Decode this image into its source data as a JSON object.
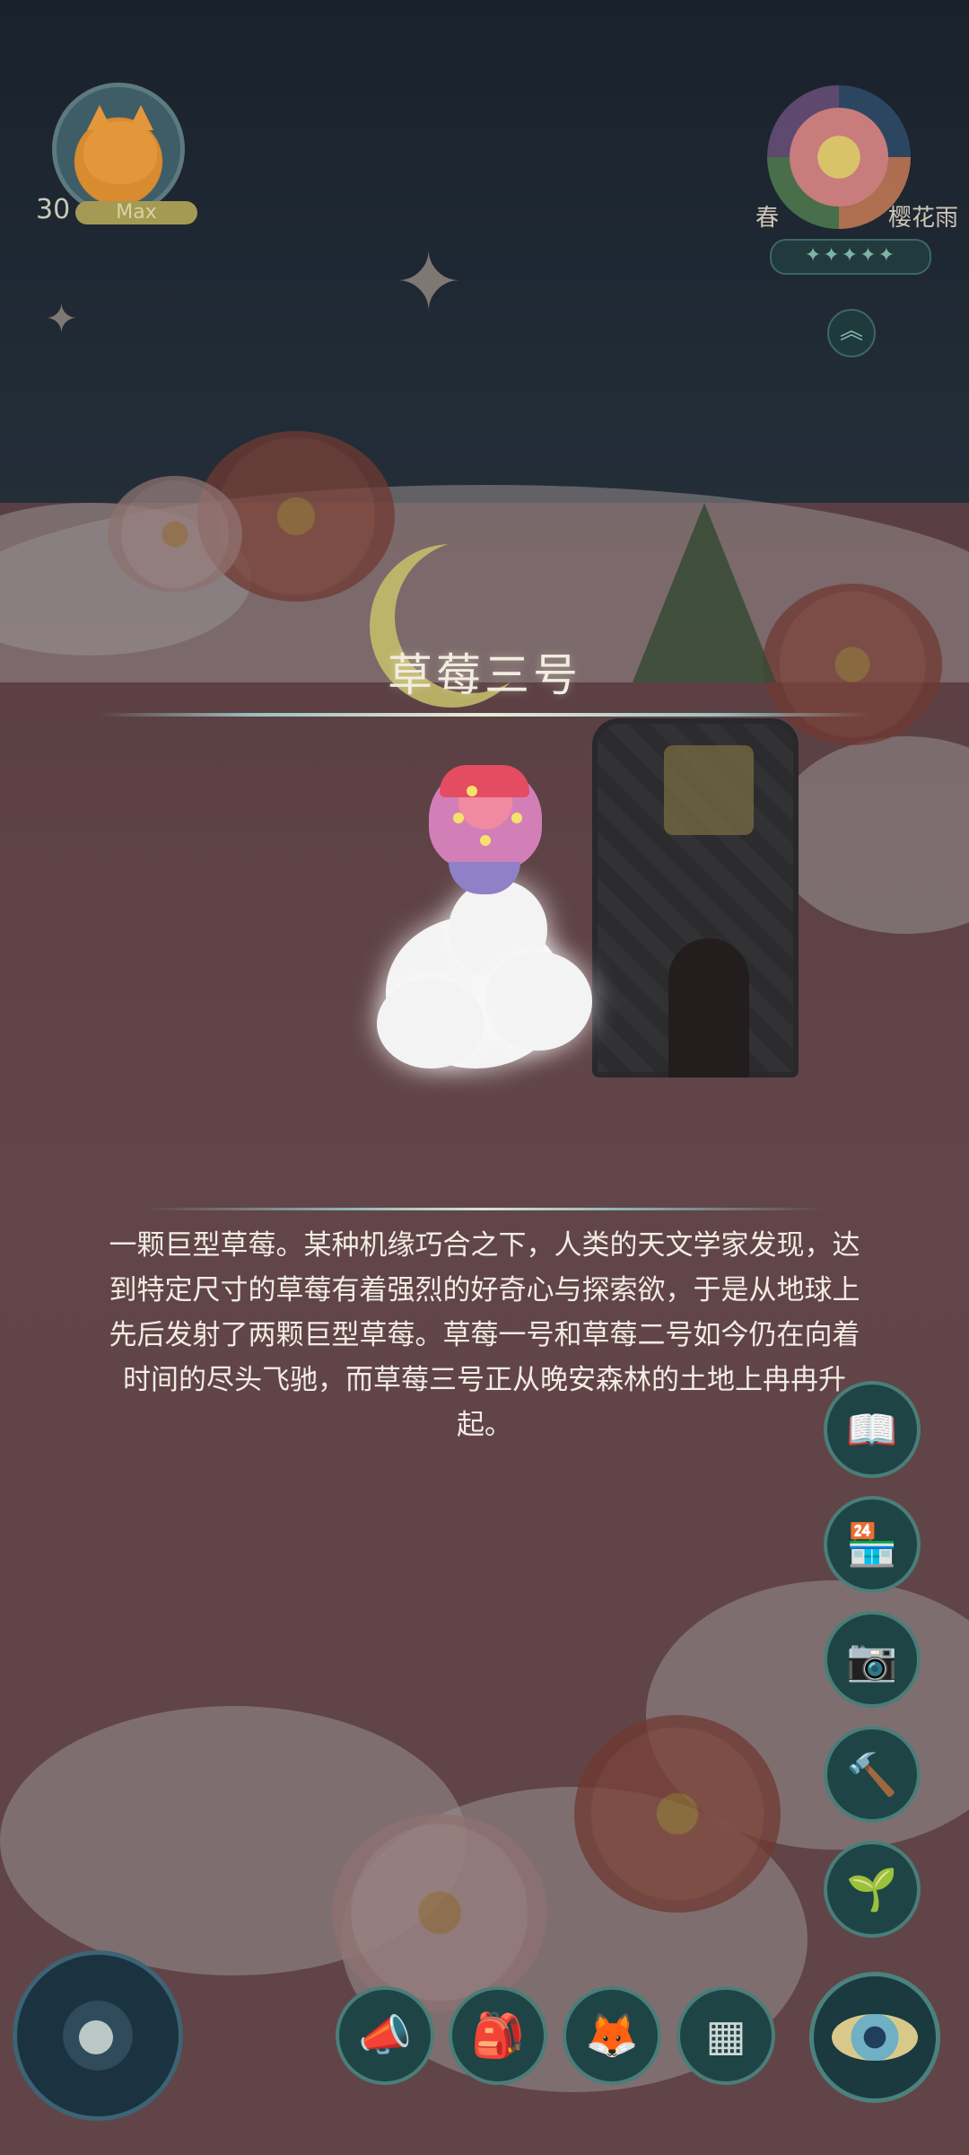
{
  "hud": {
    "player_level": "30",
    "level_status": "Max",
    "season": "春",
    "weather": "樱花雨",
    "season_stars": "✦✦✦✦✦",
    "collapse_symbol": "︽"
  },
  "item_card": {
    "title": "草莓三号",
    "description": "一颗巨型草莓。某种机缘巧合之下，人类的天文学家发现，达到特定尺寸的草莓有着强烈的好奇心与探索欲，于是从地球上先后发射了两颗巨型草莓。草莓一号和草莓二号如今仍在向着时间的尽头飞驰，而草莓三号正从晚安森林的土地上冉冉升起。"
  },
  "side_buttons": [
    {
      "icon": "book-icon",
      "glyph": "📖"
    },
    {
      "icon": "shop-icon",
      "glyph": "🏪"
    },
    {
      "icon": "camera-icon",
      "glyph": "📷"
    },
    {
      "icon": "hammer-icon",
      "glyph": "🔨"
    },
    {
      "icon": "sprout-icon",
      "glyph": "🌱"
    }
  ],
  "bottom_buttons": [
    {
      "icon": "megaphone-icon",
      "glyph": "📣"
    },
    {
      "icon": "backpack-icon",
      "glyph": "🎒"
    },
    {
      "icon": "fox-icon",
      "glyph": "🦊"
    },
    {
      "icon": "grid-icon",
      "glyph": "▦"
    }
  ],
  "colors": {
    "panel_teal": "#1f4446",
    "ring_teal": "#4a7e78",
    "title_text": "#f1ede0",
    "ground": "#8b5f61"
  }
}
